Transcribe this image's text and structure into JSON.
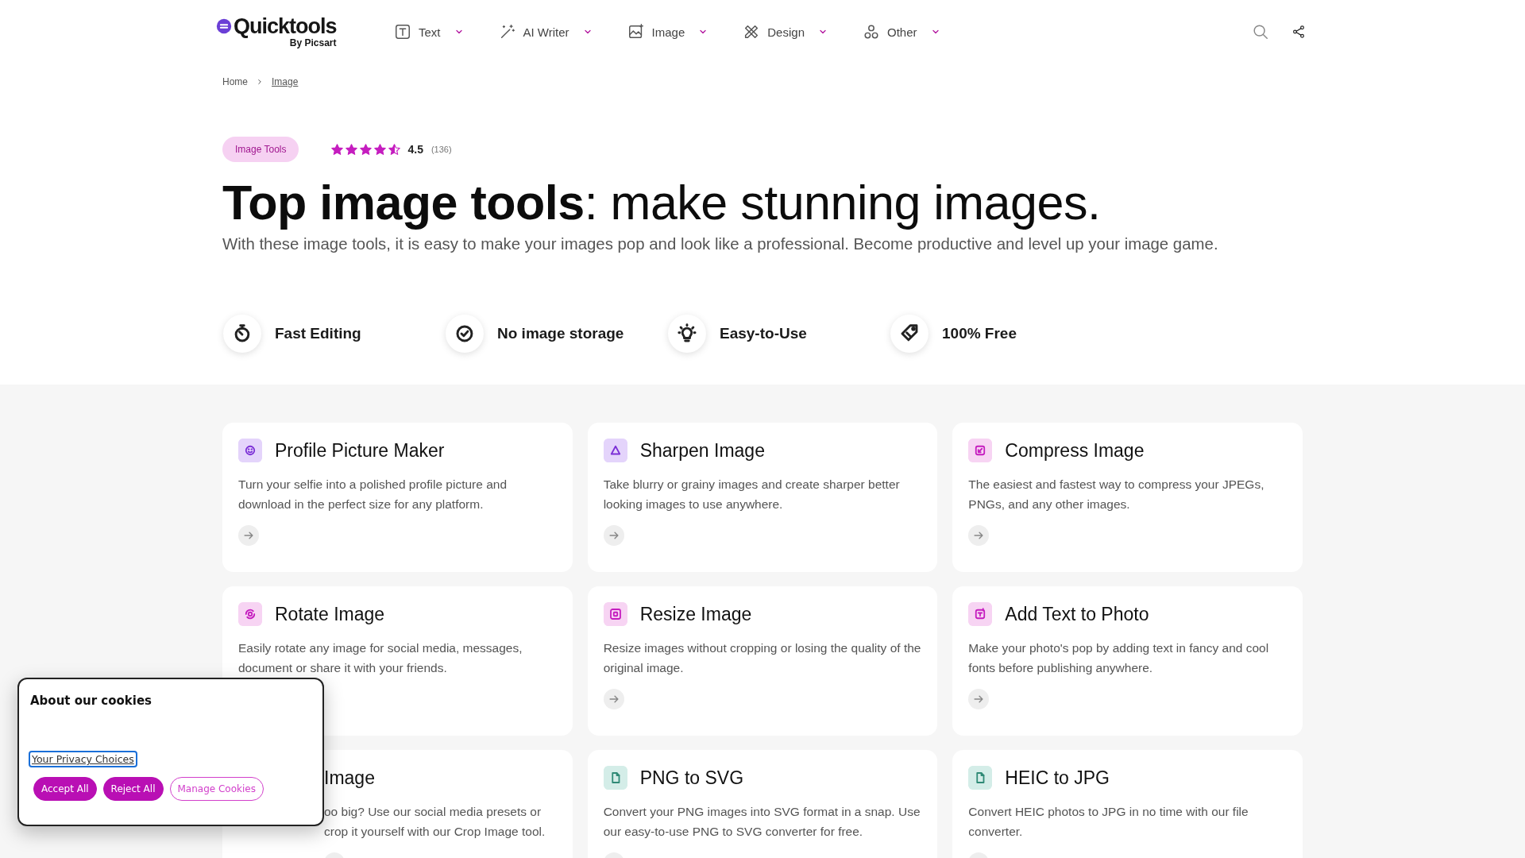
{
  "header": {
    "logo": "Quicktools",
    "logo_sub": "By Picsart",
    "nav": [
      {
        "label": "Text"
      },
      {
        "label": "AI Writer"
      },
      {
        "label": "Image"
      },
      {
        "label": "Design"
      },
      {
        "label": "Other"
      }
    ]
  },
  "breadcrumb": [
    {
      "label": "Home",
      "selected": false
    },
    {
      "label": "Image",
      "selected": true
    }
  ],
  "hero": {
    "badge": "Image Tools",
    "stars": 4.5,
    "rating": "4.5",
    "count": "(136)",
    "title": "**Top image tools**: make stunning images.",
    "subtitle": "With these image tools, it is easy to make your images pop and look like a professional. Become productive and level up your image game."
  },
  "features": [
    "Fast Editing",
    "No image storage",
    "Easy-to-Use",
    "100% Free"
  ],
  "cards": [
    {
      "title": "Profile Picture Maker",
      "description": "Turn your selfie into a polished profile picture and download in the perfect size for any platform.",
      "color": "#e4d4fb",
      "covered": false
    },
    {
      "title": "Sharpen Image",
      "description": "Take blurry or grainy images and create sharper better looking images to use anywhere.",
      "color": "#e4d4fb",
      "covered": false
    },
    {
      "title": "Compress Image",
      "description": "The easiest and fastest way to compress your JPEGs, PNGs, and any other images.",
      "color": "#f7d4f3",
      "covered": false
    },
    {
      "title": "Rotate Image",
      "description": "Easily rotate any image for social media, messages, document or share it with your friends.",
      "color": "#f7d4f3",
      "covered": false
    },
    {
      "title": "Resize Image",
      "description": "Resize images without cropping or losing the quality of the original image.",
      "color": "#f7d4f3",
      "covered": false
    },
    {
      "title": "Add Text to Photo",
      "description": "Make your photo's pop by adding text in fancy and cool fonts before publishing anywhere.",
      "color": "#f7d4f3",
      "covered": false
    },
    {
      "title": "Image",
      "description": "oo big? Use our social media presets or crop it yourself with our Crop Image tool.",
      "covered": true
    },
    {
      "title": "PNG to SVG",
      "description": "Convert your PNG images into SVG format in a snap. Use our easy-to-use PNG to SVG converter for free.",
      "color": "#d4ede8",
      "covered": false
    },
    {
      "title": "HEIC to JPG",
      "description": "Convert HEIC photos to JPG in no time with our file converter.",
      "color": "#d4ede8",
      "covered": false
    }
  ],
  "cookie_dialog": {
    "title": "About our cookies",
    "link": "Your Privacy Choices",
    "buttons": [
      {
        "label": "Accept All",
        "kind": "filled"
      },
      {
        "label": "Reject All",
        "kind": "filled"
      },
      {
        "label": "Manage Cookies",
        "kind": "outline"
      }
    ]
  }
}
